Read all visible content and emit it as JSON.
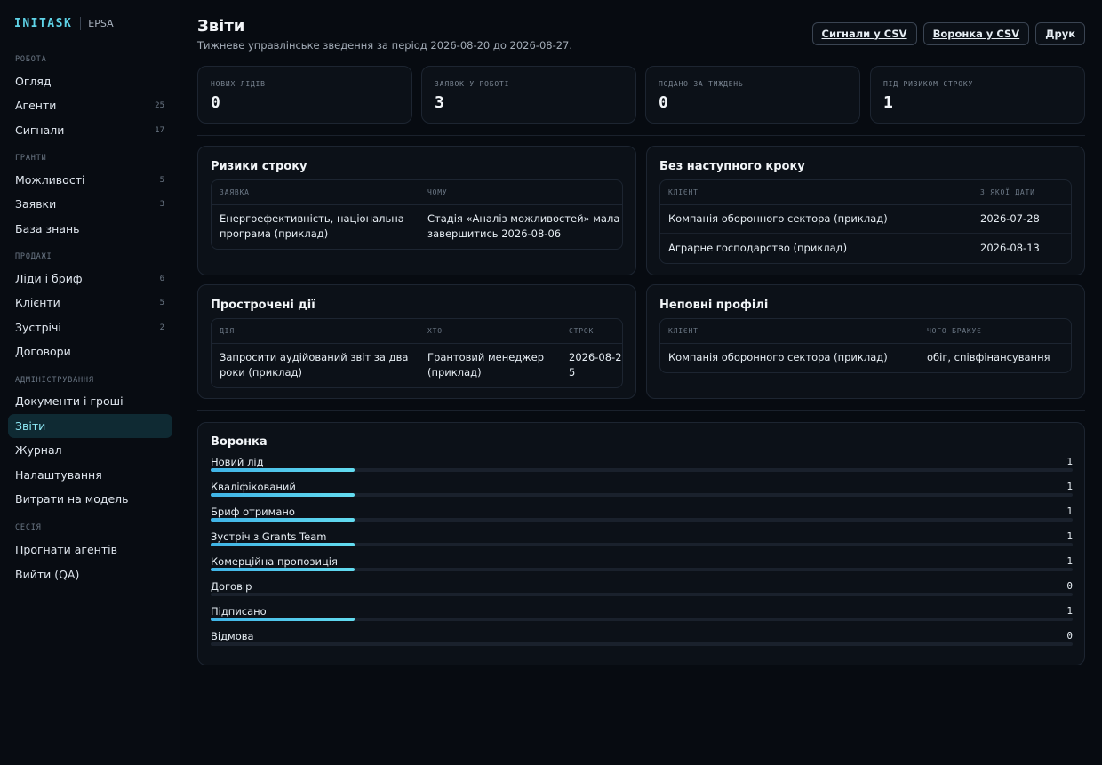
{
  "app": {
    "brand": "INITASK",
    "org": "EPSA"
  },
  "sidebar": {
    "sections": [
      {
        "title": "РОБОТА",
        "items": [
          {
            "label": "Огляд",
            "count": ""
          },
          {
            "label": "Агенти",
            "count": "25"
          },
          {
            "label": "Сигнали",
            "count": "17"
          }
        ]
      },
      {
        "title": "ГРАНТИ",
        "items": [
          {
            "label": "Можливості",
            "count": "5"
          },
          {
            "label": "Заявки",
            "count": "3"
          },
          {
            "label": "База знань",
            "count": ""
          }
        ]
      },
      {
        "title": "ПРОДАЖІ",
        "items": [
          {
            "label": "Ліди і бриф",
            "count": "6"
          },
          {
            "label": "Клієнти",
            "count": "5"
          },
          {
            "label": "Зустрічі",
            "count": "2"
          },
          {
            "label": "Договори",
            "count": ""
          }
        ]
      },
      {
        "title": "АДМІНІСТРУВАННЯ",
        "items": [
          {
            "label": "Документи і гроші",
            "count": ""
          },
          {
            "label": "Звіти",
            "count": "",
            "active": true
          },
          {
            "label": "Журнал",
            "count": ""
          },
          {
            "label": "Налаштування",
            "count": ""
          },
          {
            "label": "Витрати на модель",
            "count": ""
          }
        ]
      },
      {
        "title": "СЕСІЯ",
        "items": [
          {
            "label": "Прогнати агентів",
            "count": ""
          },
          {
            "label": "Вийти (QA)",
            "count": ""
          }
        ]
      }
    ]
  },
  "header": {
    "title": "Звіти",
    "subtitle": "Тижневе управлінське зведення за період 2026-08-20 до 2026-08-27.",
    "actions": {
      "signals_csv": "Сигнали у CSV",
      "funnel_csv": "Воронка у CSV",
      "print": "Друк"
    }
  },
  "kpis": [
    {
      "label": "НОВИХ ЛІДІВ",
      "value": "0"
    },
    {
      "label": "ЗАЯВОК У РОБОТІ",
      "value": "3"
    },
    {
      "label": "ПОДАНО ЗА ТИЖДЕНЬ",
      "value": "0"
    },
    {
      "label": "ПІД РИЗИКОМ СТРОКУ",
      "value": "1"
    }
  ],
  "deadline_risks": {
    "title": "Ризики строку",
    "columns": [
      "ЗАЯВКА",
      "ЧОМУ"
    ],
    "rows": [
      [
        "Енергоефективність, національна програма (приклад)",
        "Стадія «Аналіз можливостей» мала завершитись 2026-08-06"
      ]
    ]
  },
  "no_next_step": {
    "title": "Без наступного кроку",
    "columns": [
      "КЛІЄНТ",
      "З ЯКОЇ ДАТИ"
    ],
    "rows": [
      [
        "Компанія оборонного сектора (приклад)",
        "2026-07-28"
      ],
      [
        "Аграрне господарство (приклад)",
        "2026-08-13"
      ]
    ]
  },
  "overdue": {
    "title": "Прострочені дії",
    "columns": [
      "ДІЯ",
      "ХТО",
      "СТРОК"
    ],
    "rows": [
      [
        "Запросити аудійований звіт за два роки (приклад)",
        "Грантовий менеджер (приклад)",
        "2026-08-25"
      ]
    ]
  },
  "incomplete_profiles": {
    "title": "Неповні профілі",
    "columns": [
      "КЛІЄНТ",
      "ЧОГО БРАКУЄ"
    ],
    "rows": [
      [
        "Компанія оборонного сектора (приклад)",
        "обіг, співфінансування"
      ]
    ]
  },
  "funnel": {
    "title": "Воронка",
    "max": 6,
    "stages": [
      {
        "label": "Новий лід",
        "value": 1
      },
      {
        "label": "Кваліфікований",
        "value": 1
      },
      {
        "label": "Бриф отримано",
        "value": 1
      },
      {
        "label": "Зустріч з Grants Team",
        "value": 1
      },
      {
        "label": "Комерційна пропозиція",
        "value": 1
      },
      {
        "label": "Договір",
        "value": 0
      },
      {
        "label": "Підписано",
        "value": 1
      },
      {
        "label": "Відмова",
        "value": 0
      }
    ]
  }
}
